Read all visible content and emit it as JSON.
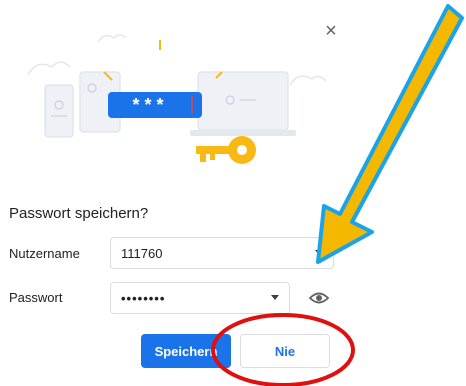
{
  "dialog": {
    "close_icon": "×",
    "title": "Passwort speichern?",
    "illustration": {
      "masked_text": "* * *"
    }
  },
  "form": {
    "username_label": "Nutzername",
    "username_value": "111760",
    "password_label": "Passwort",
    "password_value": "••••••••"
  },
  "buttons": {
    "save_label": "Speichern",
    "never_label": "Nie"
  },
  "colors": {
    "primary": "#1a73e8",
    "annotation_arrow_fill": "#f5b800",
    "annotation_arrow_outline": "#1aa3e8",
    "annotation_circle": "#e01010",
    "key_yellow": "#f9b914"
  },
  "icons": {
    "close": "close-icon",
    "eye": "eye-icon",
    "caret": "chevron-down-icon",
    "key": "key-icon"
  }
}
